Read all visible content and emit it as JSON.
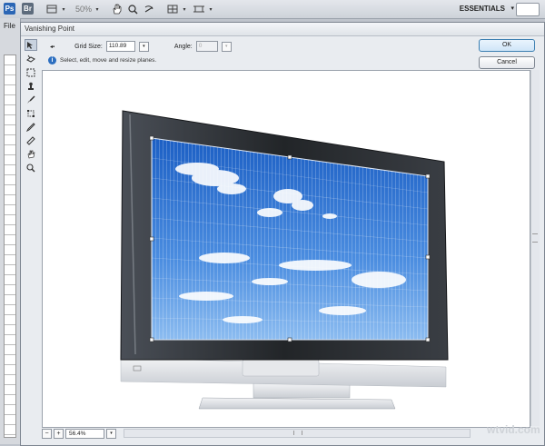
{
  "appbar": {
    "ps_badge": "Ps",
    "br_badge": "Br",
    "zoom": "50%",
    "workspace": "ESSENTIALS"
  },
  "ps_window": {
    "menu_file": "File"
  },
  "dialog": {
    "title": "Vanishing Point",
    "grid_size_label": "Grid Size:",
    "grid_size_value": "110.89",
    "angle_label": "Angle:",
    "angle_value": "0",
    "hint": "Select, edit, move and resize planes.",
    "ok_label": "OK",
    "cancel_label": "Cancel",
    "zoom_value": "56.4%"
  },
  "icons": [
    "edit-plane-tool-icon",
    "create-plane-tool-icon",
    "marquee-tool-icon",
    "stamp-tool-icon",
    "brush-tool-icon",
    "transform-tool-icon",
    "eyedropper-tool-icon",
    "measure-tool-icon",
    "hand-tool-icon",
    "zoom-tool-icon",
    "info-icon"
  ],
  "colors": {
    "accent": "#2b66b5",
    "ok_button": "#cfe5f8",
    "sky_top": "#1c5fc4",
    "sky_bottom": "#6fa6e6"
  },
  "watermark": "wtvid.com"
}
